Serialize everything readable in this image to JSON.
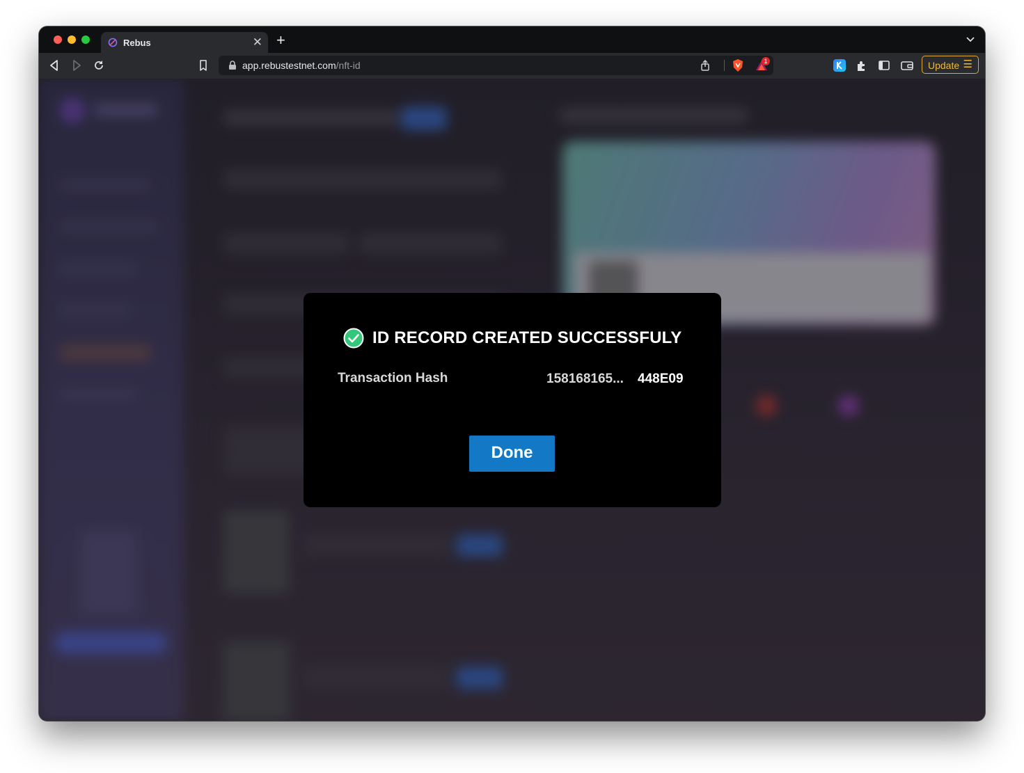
{
  "browser": {
    "tab": {
      "title": "Rebus",
      "close_glyph": "✕"
    },
    "new_tab_glyph": "+",
    "url": {
      "host": "app.rebustestnet.com",
      "path": "/nft-id"
    },
    "update_button": {
      "label": "Update",
      "menu_glyph": "☰"
    },
    "brave_rewards_badge": "1"
  },
  "modal": {
    "title": "ID RECORD CREATED SUCCESSFULY",
    "transaction_hash_label": "Transaction Hash",
    "transaction_hash_prefix": "158168165...",
    "transaction_hash_suffix": "448E09",
    "done_label": "Done"
  },
  "colors": {
    "accent_blue": "#1378c6",
    "success_green": "#34c77b",
    "update_gold": "#f1b934"
  }
}
